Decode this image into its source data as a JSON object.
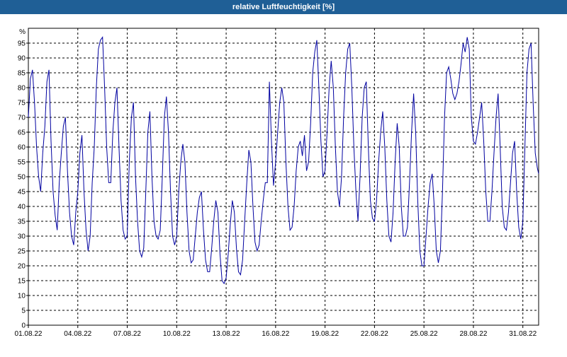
{
  "window": {
    "title": "relative Luftfeuchtigkeit [%]"
  },
  "chart_data": {
    "type": "line",
    "title": "relative Luftfeuchtigkeit [%]",
    "ylabel": "%",
    "xlabel": "",
    "ylim": [
      0,
      100
    ],
    "xlim": [
      "2022-08-01",
      "2022-08-31T23:00"
    ],
    "grid": true,
    "line_color": "#0000a0",
    "x_ticks": [
      "01.08.22",
      "04.08.22",
      "07.08.22",
      "10.08.22",
      "13.08.22",
      "16.08.22",
      "19.08.22",
      "22.08.22",
      "25.08.22",
      "28.08.22",
      "31.08.22"
    ],
    "y_ticks": [
      0,
      5,
      10,
      15,
      20,
      25,
      30,
      35,
      40,
      45,
      50,
      55,
      60,
      65,
      70,
      75,
      80,
      85,
      90,
      95
    ],
    "series": [
      {
        "name": "",
        "points": [
          [
            "2022-08-01T00:00",
            70
          ],
          [
            "2022-08-01T03:00",
            83
          ],
          [
            "2022-08-01T06:00",
            86
          ],
          [
            "2022-08-01T09:00",
            75
          ],
          [
            "2022-08-01T12:00",
            60
          ],
          [
            "2022-08-01T15:00",
            50
          ],
          [
            "2022-08-01T18:00",
            45
          ],
          [
            "2022-08-01T21:00",
            58
          ],
          [
            "2022-08-02T00:00",
            67
          ],
          [
            "2022-08-02T03:00",
            82
          ],
          [
            "2022-08-02T06:00",
            86
          ],
          [
            "2022-08-02T09:00",
            62
          ],
          [
            "2022-08-02T12:00",
            45
          ],
          [
            "2022-08-02T15:00",
            37
          ],
          [
            "2022-08-02T18:00",
            32
          ],
          [
            "2022-08-02T21:00",
            48
          ],
          [
            "2022-08-03T00:00",
            58
          ],
          [
            "2022-08-03T03:00",
            67
          ],
          [
            "2022-08-03T06:00",
            70
          ],
          [
            "2022-08-03T09:00",
            52
          ],
          [
            "2022-08-03T12:00",
            38
          ],
          [
            "2022-08-03T15:00",
            30
          ],
          [
            "2022-08-03T18:00",
            27
          ],
          [
            "2022-08-03T21:00",
            38
          ],
          [
            "2022-08-04T00:00",
            45
          ],
          [
            "2022-08-04T03:00",
            58
          ],
          [
            "2022-08-04T06:00",
            64
          ],
          [
            "2022-08-04T09:00",
            45
          ],
          [
            "2022-08-04T12:00",
            32
          ],
          [
            "2022-08-04T15:00",
            25
          ],
          [
            "2022-08-04T18:00",
            30
          ],
          [
            "2022-08-04T21:00",
            48
          ],
          [
            "2022-08-05T00:00",
            60
          ],
          [
            "2022-08-05T03:00",
            80
          ],
          [
            "2022-08-05T06:00",
            93
          ],
          [
            "2022-08-05T09:00",
            96
          ],
          [
            "2022-08-05T12:00",
            97
          ],
          [
            "2022-08-05T15:00",
            80
          ],
          [
            "2022-08-05T18:00",
            60
          ],
          [
            "2022-08-05T21:00",
            48
          ],
          [
            "2022-08-06T00:00",
            48
          ],
          [
            "2022-08-06T03:00",
            65
          ],
          [
            "2022-08-06T06:00",
            75
          ],
          [
            "2022-08-06T09:00",
            80
          ],
          [
            "2022-08-06T12:00",
            60
          ],
          [
            "2022-08-06T15:00",
            42
          ],
          [
            "2022-08-06T18:00",
            32
          ],
          [
            "2022-08-06T21:00",
            29
          ],
          [
            "2022-08-07T00:00",
            30
          ],
          [
            "2022-08-07T03:00",
            55
          ],
          [
            "2022-08-07T06:00",
            70
          ],
          [
            "2022-08-07T09:00",
            75
          ],
          [
            "2022-08-07T12:00",
            50
          ],
          [
            "2022-08-07T15:00",
            35
          ],
          [
            "2022-08-07T18:00",
            25
          ],
          [
            "2022-08-07T21:00",
            23
          ],
          [
            "2022-08-08T00:00",
            26
          ],
          [
            "2022-08-08T03:00",
            45
          ],
          [
            "2022-08-08T06:00",
            65
          ],
          [
            "2022-08-08T09:00",
            72
          ],
          [
            "2022-08-08T12:00",
            50
          ],
          [
            "2022-08-08T15:00",
            35
          ],
          [
            "2022-08-08T18:00",
            30
          ],
          [
            "2022-08-08T21:00",
            29
          ],
          [
            "2022-08-09T00:00",
            32
          ],
          [
            "2022-08-09T03:00",
            50
          ],
          [
            "2022-08-09T06:00",
            70
          ],
          [
            "2022-08-09T09:00",
            77
          ],
          [
            "2022-08-09T12:00",
            65
          ],
          [
            "2022-08-09T15:00",
            45
          ],
          [
            "2022-08-09T18:00",
            30
          ],
          [
            "2022-08-09T21:00",
            27
          ],
          [
            "2022-08-10T00:00",
            30
          ],
          [
            "2022-08-10T03:00",
            45
          ],
          [
            "2022-08-10T06:00",
            55
          ],
          [
            "2022-08-10T09:00",
            61
          ],
          [
            "2022-08-10T12:00",
            55
          ],
          [
            "2022-08-10T15:00",
            38
          ],
          [
            "2022-08-10T18:00",
            25
          ],
          [
            "2022-08-10T21:00",
            21
          ],
          [
            "2022-08-11T00:00",
            22
          ],
          [
            "2022-08-11T03:00",
            30
          ],
          [
            "2022-08-11T06:00",
            38
          ],
          [
            "2022-08-11T09:00",
            43
          ],
          [
            "2022-08-11T12:00",
            45
          ],
          [
            "2022-08-11T15:00",
            32
          ],
          [
            "2022-08-11T18:00",
            22
          ],
          [
            "2022-08-11T21:00",
            18
          ],
          [
            "2022-08-12T00:00",
            18
          ],
          [
            "2022-08-12T03:00",
            26
          ],
          [
            "2022-08-12T06:00",
            35
          ],
          [
            "2022-08-12T09:00",
            42
          ],
          [
            "2022-08-12T12:00",
            38
          ],
          [
            "2022-08-12T15:00",
            24
          ],
          [
            "2022-08-12T18:00",
            15
          ],
          [
            "2022-08-12T21:00",
            14
          ],
          [
            "2022-08-13T00:00",
            16
          ],
          [
            "2022-08-13T03:00",
            24
          ],
          [
            "2022-08-13T06:00",
            34
          ],
          [
            "2022-08-13T09:00",
            42
          ],
          [
            "2022-08-13T12:00",
            38
          ],
          [
            "2022-08-13T15:00",
            26
          ],
          [
            "2022-08-13T18:00",
            18
          ],
          [
            "2022-08-13T21:00",
            17
          ],
          [
            "2022-08-14T00:00",
            22
          ],
          [
            "2022-08-14T03:00",
            35
          ],
          [
            "2022-08-14T06:00",
            48
          ],
          [
            "2022-08-14T09:00",
            59
          ],
          [
            "2022-08-14T12:00",
            55
          ],
          [
            "2022-08-14T15:00",
            40
          ],
          [
            "2022-08-14T18:00",
            28
          ],
          [
            "2022-08-14T21:00",
            25
          ],
          [
            "2022-08-15T00:00",
            27
          ],
          [
            "2022-08-15T03:00",
            35
          ],
          [
            "2022-08-15T06:00",
            42
          ],
          [
            "2022-08-15T09:00",
            48
          ],
          [
            "2022-08-15T12:00",
            48
          ],
          [
            "2022-08-15T15:00",
            82
          ],
          [
            "2022-08-15T18:00",
            62
          ],
          [
            "2022-08-15T21:00",
            47
          ],
          [
            "2022-08-16T00:00",
            55
          ],
          [
            "2022-08-16T03:00",
            65
          ],
          [
            "2022-08-16T06:00",
            75
          ],
          [
            "2022-08-16T09:00",
            80
          ],
          [
            "2022-08-16T12:00",
            75
          ],
          [
            "2022-08-16T15:00",
            55
          ],
          [
            "2022-08-16T18:00",
            40
          ],
          [
            "2022-08-16T21:00",
            32
          ],
          [
            "2022-08-17T00:00",
            33
          ],
          [
            "2022-08-17T03:00",
            40
          ],
          [
            "2022-08-17T06:00",
            52
          ],
          [
            "2022-08-17T09:00",
            60
          ],
          [
            "2022-08-17T12:00",
            62
          ],
          [
            "2022-08-17T15:00",
            57
          ],
          [
            "2022-08-17T18:00",
            64
          ],
          [
            "2022-08-17T21:00",
            52
          ],
          [
            "2022-08-18T00:00",
            55
          ],
          [
            "2022-08-18T03:00",
            68
          ],
          [
            "2022-08-18T06:00",
            85
          ],
          [
            "2022-08-18T09:00",
            92
          ],
          [
            "2022-08-18T12:00",
            96
          ],
          [
            "2022-08-18T15:00",
            80
          ],
          [
            "2022-08-18T18:00",
            62
          ],
          [
            "2022-08-18T21:00",
            50
          ],
          [
            "2022-08-19T00:00",
            52
          ],
          [
            "2022-08-19T03:00",
            65
          ],
          [
            "2022-08-19T06:00",
            80
          ],
          [
            "2022-08-19T09:00",
            89
          ],
          [
            "2022-08-19T12:00",
            80
          ],
          [
            "2022-08-19T15:00",
            60
          ],
          [
            "2022-08-19T18:00",
            45
          ],
          [
            "2022-08-19T21:00",
            40
          ],
          [
            "2022-08-20T00:00",
            50
          ],
          [
            "2022-08-20T03:00",
            70
          ],
          [
            "2022-08-20T06:00",
            85
          ],
          [
            "2022-08-20T09:00",
            93
          ],
          [
            "2022-08-20T12:00",
            95
          ],
          [
            "2022-08-20T15:00",
            80
          ],
          [
            "2022-08-20T18:00",
            60
          ],
          [
            "2022-08-20T21:00",
            45
          ],
          [
            "2022-08-21T00:00",
            35
          ],
          [
            "2022-08-21T03:00",
            50
          ],
          [
            "2022-08-21T06:00",
            70
          ],
          [
            "2022-08-21T09:00",
            80
          ],
          [
            "2022-08-21T12:00",
            82
          ],
          [
            "2022-08-21T15:00",
            60
          ],
          [
            "2022-08-21T18:00",
            42
          ],
          [
            "2022-08-21T21:00",
            36
          ],
          [
            "2022-08-22T00:00",
            35
          ],
          [
            "2022-08-22T03:00",
            42
          ],
          [
            "2022-08-22T06:00",
            55
          ],
          [
            "2022-08-22T09:00",
            65
          ],
          [
            "2022-08-22T12:00",
            72
          ],
          [
            "2022-08-22T15:00",
            60
          ],
          [
            "2022-08-22T18:00",
            42
          ],
          [
            "2022-08-22T21:00",
            30
          ],
          [
            "2022-08-23T00:00",
            28
          ],
          [
            "2022-08-23T03:00",
            38
          ],
          [
            "2022-08-23T06:00",
            55
          ],
          [
            "2022-08-23T09:00",
            68
          ],
          [
            "2022-08-23T12:00",
            60
          ],
          [
            "2022-08-23T15:00",
            40
          ],
          [
            "2022-08-23T18:00",
            30
          ],
          [
            "2022-08-23T21:00",
            30
          ],
          [
            "2022-08-24T00:00",
            33
          ],
          [
            "2022-08-24T03:00",
            48
          ],
          [
            "2022-08-24T06:00",
            65
          ],
          [
            "2022-08-24T09:00",
            78
          ],
          [
            "2022-08-24T12:00",
            65
          ],
          [
            "2022-08-24T15:00",
            42
          ],
          [
            "2022-08-24T18:00",
            25
          ],
          [
            "2022-08-24T21:00",
            20
          ],
          [
            "2022-08-25T00:00",
            20
          ],
          [
            "2022-08-25T03:00",
            30
          ],
          [
            "2022-08-25T06:00",
            40
          ],
          [
            "2022-08-25T09:00",
            48
          ],
          [
            "2022-08-25T12:00",
            51
          ],
          [
            "2022-08-25T15:00",
            40
          ],
          [
            "2022-08-25T18:00",
            25
          ],
          [
            "2022-08-25T21:00",
            21
          ],
          [
            "2022-08-26T00:00",
            25
          ],
          [
            "2022-08-26T03:00",
            45
          ],
          [
            "2022-08-26T06:00",
            70
          ],
          [
            "2022-08-26T09:00",
            85
          ],
          [
            "2022-08-26T12:00",
            87
          ],
          [
            "2022-08-26T15:00",
            83
          ],
          [
            "2022-08-26T18:00",
            78
          ],
          [
            "2022-08-26T21:00",
            76
          ],
          [
            "2022-08-27T00:00",
            78
          ],
          [
            "2022-08-27T03:00",
            82
          ],
          [
            "2022-08-27T06:00",
            88
          ],
          [
            "2022-08-27T09:00",
            95
          ],
          [
            "2022-08-27T12:00",
            92
          ],
          [
            "2022-08-27T15:00",
            97
          ],
          [
            "2022-08-27T18:00",
            93
          ],
          [
            "2022-08-27T21:00",
            70
          ],
          [
            "2022-08-28T00:00",
            62
          ],
          [
            "2022-08-28T03:00",
            61
          ],
          [
            "2022-08-28T06:00",
            65
          ],
          [
            "2022-08-28T09:00",
            70
          ],
          [
            "2022-08-28T12:00",
            75
          ],
          [
            "2022-08-28T15:00",
            62
          ],
          [
            "2022-08-28T18:00",
            45
          ],
          [
            "2022-08-28T21:00",
            35
          ],
          [
            "2022-08-29T00:00",
            35
          ],
          [
            "2022-08-29T03:00",
            45
          ],
          [
            "2022-08-29T06:00",
            58
          ],
          [
            "2022-08-29T09:00",
            70
          ],
          [
            "2022-08-29T12:00",
            78
          ],
          [
            "2022-08-29T15:00",
            60
          ],
          [
            "2022-08-29T18:00",
            40
          ],
          [
            "2022-08-29T21:00",
            33
          ],
          [
            "2022-08-30T00:00",
            32
          ],
          [
            "2022-08-30T03:00",
            38
          ],
          [
            "2022-08-30T06:00",
            48
          ],
          [
            "2022-08-30T09:00",
            58
          ],
          [
            "2022-08-30T12:00",
            62
          ],
          [
            "2022-08-30T15:00",
            45
          ],
          [
            "2022-08-30T18:00",
            33
          ],
          [
            "2022-08-30T21:00",
            29
          ],
          [
            "2022-08-31T00:00",
            35
          ],
          [
            "2022-08-31T03:00",
            60
          ],
          [
            "2022-08-31T06:00",
            85
          ],
          [
            "2022-08-31T09:00",
            93
          ],
          [
            "2022-08-31T12:00",
            95
          ],
          [
            "2022-08-31T15:00",
            75
          ],
          [
            "2022-08-31T18:00",
            58
          ],
          [
            "2022-08-31T21:00",
            53
          ],
          [
            "2022-08-31T23:00",
            51
          ]
        ]
      }
    ]
  }
}
